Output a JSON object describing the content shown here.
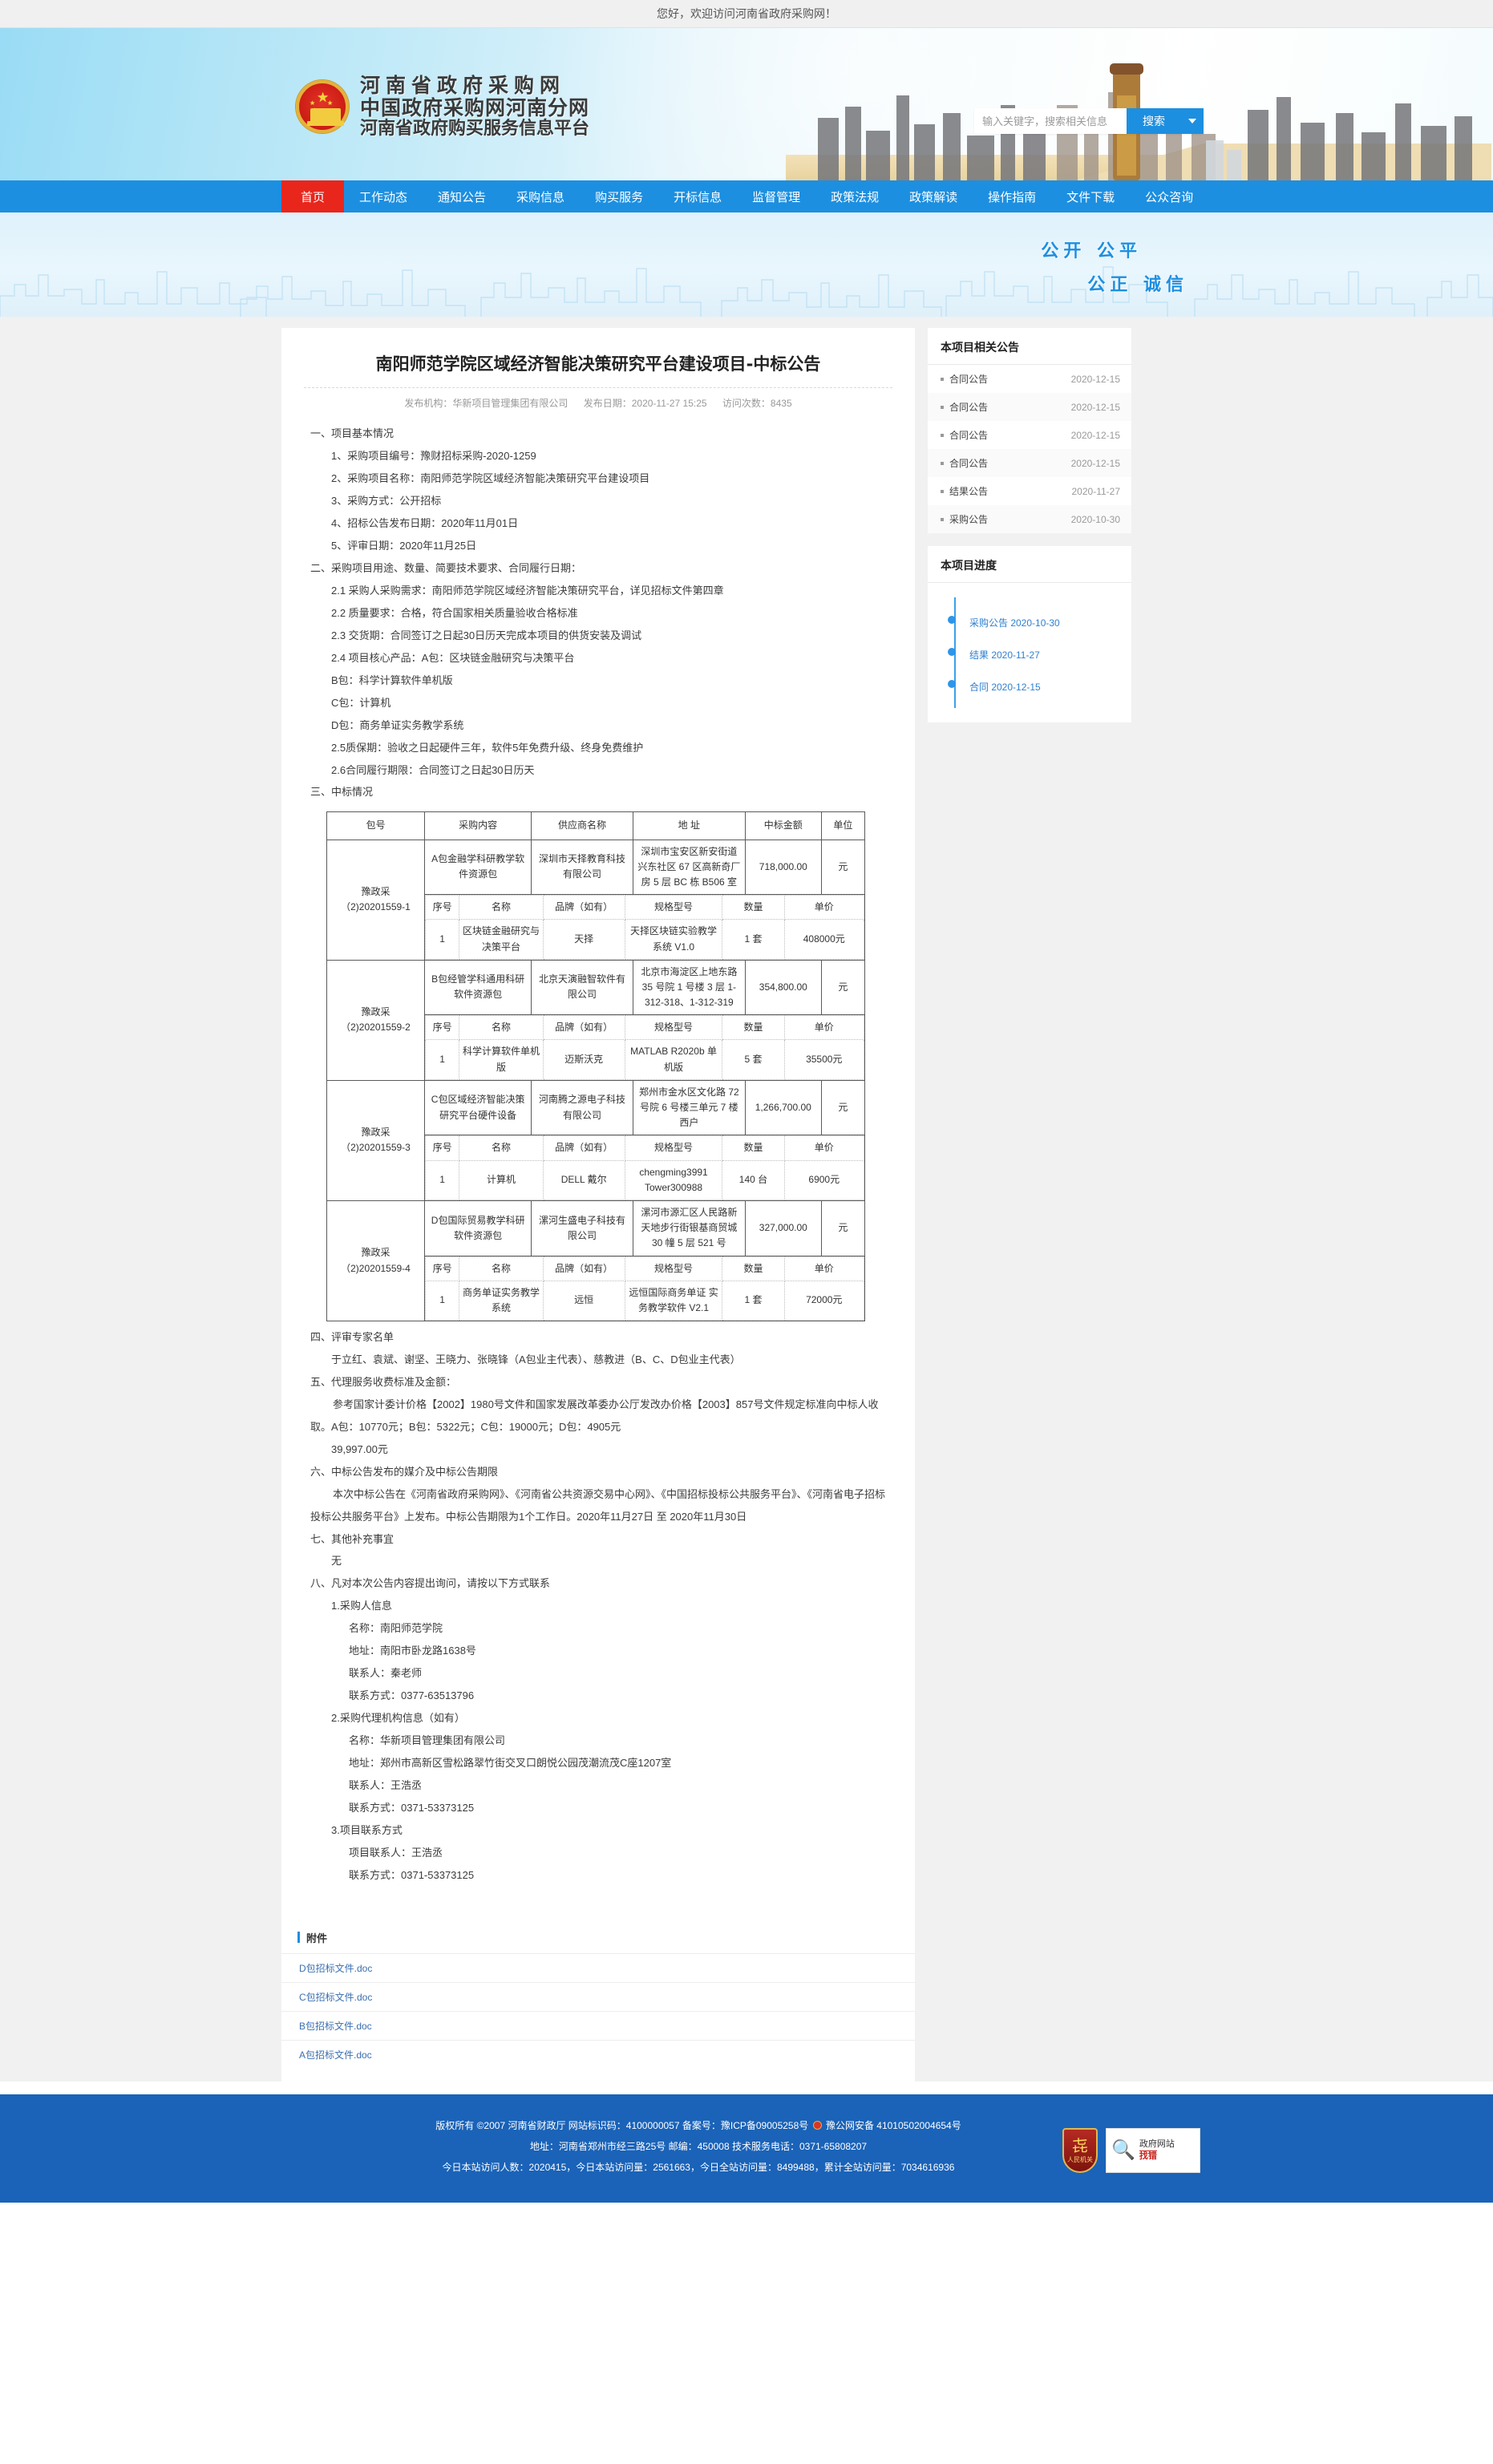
{
  "topbar": {
    "greeting": "您好，欢迎访问河南省政府采购网！"
  },
  "header": {
    "site_title_1": "河南省政府采购网",
    "site_title_2": "中国政府采购网河南分网",
    "site_title_3": "河南省政府购买服务信息平台",
    "search_placeholder": "输入关键字，搜索相关信息",
    "search_value": "",
    "search_button": "搜索"
  },
  "nav": {
    "items": [
      {
        "label": "首页",
        "active": true
      },
      {
        "label": "工作动态"
      },
      {
        "label": "通知公告"
      },
      {
        "label": "采购信息"
      },
      {
        "label": "购买服务"
      },
      {
        "label": "开标信息"
      },
      {
        "label": "监督管理"
      },
      {
        "label": "政策法规"
      },
      {
        "label": "政策解读"
      },
      {
        "label": "操作指南"
      },
      {
        "label": "文件下载"
      },
      {
        "label": "公众咨询"
      }
    ]
  },
  "banner": {
    "slogan_line1": "公开    公平",
    "slogan_line2": "公正    诚信"
  },
  "article": {
    "title": "南阳师范学院区域经济智能决策研究平台建设项目-中标公告",
    "meta_publisher": "发布机构：华新项目管理集团有限公司",
    "meta_date": "发布日期：2020-11-27 15:25",
    "meta_views": "访问次数：8435",
    "s1_head": "一、项目基本情况",
    "s1_1": "1、采购项目编号：豫财招标采购-2020-1259",
    "s1_2": "2、采购项目名称：南阳师范学院区域经济智能决策研究平台建设项目",
    "s1_3": "3、采购方式：公开招标",
    "s1_4": "4、招标公告发布日期：2020年11月01日",
    "s1_5": "5、评审日期：2020年11月25日",
    "s2_head": "二、采购项目用途、数量、简要技术要求、合同履行日期：",
    "s2_1": "2.1 采购人采购需求：南阳师范学院区域经济智能决策研究平台，详见招标文件第四章",
    "s2_2": "2.2 质量要求：合格，符合国家相关质量验收合格标准",
    "s2_3": "2.3 交货期：合同签订之日起30日历天完成本项目的供货安装及调试",
    "s2_4": "2.4 项目核心产品：A包：区块链金融研究与决策平台",
    "s2_4b": "B包：科学计算软件单机版",
    "s2_4c": "C包：计算机",
    "s2_4d": "D包：商务单证实务教学系统",
    "s2_5": "2.5质保期：验收之日起硬件三年，软件5年免费升级、终身免费维护",
    "s2_6": "2.6合同履行期限：合同签订之日起30日历天",
    "s3_head": "三、中标情况",
    "s4_head": "四、评审专家名单",
    "s4_body": "于立红、袁斌、谢坚、王晓力、张晓锋（A包业主代表）、慈教进（B、C、D包业主代表）",
    "s5_head": "五、代理服务收费标准及金额：",
    "s5_body": "参考国家计委计价格【2002】1980号文件和国家发展改革委办公厅发改办价格【2003】857号文件规定标准向中标人收取。A包：10770元；B包：5322元；C包：19000元；D包：4905元",
    "s5_total": "39,997.00元",
    "s6_head": "六、中标公告发布的媒介及中标公告期限",
    "s6_body": "本次中标公告在《河南省政府采购网》、《河南省公共资源交易中心网》、《中国招标投标公共服务平台》、《河南省电子招标投标公共服务平台》上发布。中标公告期限为1个工作日。2020年11月27日 至 2020年11月30日",
    "s7_head": "七、其他补充事宜",
    "s7_body": "无",
    "s8_head": "八、凡对本次公告内容提出询问，请按以下方式联系",
    "c1_head": "1.采购人信息",
    "c1_name": "名称：南阳师范学院",
    "c1_addr": "地址：南阳市卧龙路1638号",
    "c1_person": "联系人：秦老师",
    "c1_tel": "联系方式：0377-63513796",
    "c2_head": "2.采购代理机构信息（如有）",
    "c2_name": "名称：华新项目管理集团有限公司",
    "c2_addr": "地址：郑州市高新区雪松路翠竹街交叉口朗悦公园茂潮流茂C座1207室",
    "c2_person": "联系人：王浩丞",
    "c2_tel": "联系方式：0371-53373125",
    "c3_head": "3.项目联系方式",
    "c3_person": "项目联系人：王浩丞",
    "c3_tel": "联系方式：0371-53373125"
  },
  "table": {
    "headers": [
      "包号",
      "采购内容",
      "供应商名称",
      "地 址",
      "中标金额",
      "单位"
    ],
    "sub_headers": [
      "序号",
      "名称",
      "品牌（如有）",
      "规格型号",
      "数量",
      "单价"
    ],
    "packages": [
      {
        "pkg_no": "豫政采（2)20201559-1",
        "content": "A包金融学科研教学软件资源包",
        "supplier": "深圳市天择教育科技有限公司",
        "address": "深圳市宝安区新安街道兴东社区 67 区高新奇厂房 5 层 BC 栋 B506 室",
        "amount": "718,000.00",
        "unit": "元",
        "items": [
          {
            "no": "1",
            "name": "区块链金融研究与 决策平台",
            "brand": "天择",
            "spec": "天择区块链实验教学系统 V1.0",
            "qty": "1 套",
            "price": "408000元"
          }
        ]
      },
      {
        "pkg_no": "豫政采（2)20201559-2",
        "content": "B包经管学科通用科研软件资源包",
        "supplier": "北京天演融智软件有限公司",
        "address": "北京市海淀区上地东路 35 号院 1 号楼 3 层 1-312-318、1-312-319",
        "amount": "354,800.00",
        "unit": "元",
        "items": [
          {
            "no": "1",
            "name": "科学计算软件单机版",
            "brand": "迈斯沃克",
            "spec": "MATLAB R2020b 单机版",
            "qty": "5 套",
            "price": "35500元"
          }
        ]
      },
      {
        "pkg_no": "豫政采（2)20201559-3",
        "content": "C包区域经济智能决策研究平台硬件设备",
        "supplier": "河南腾之源电子科技有限公司",
        "address": "郑州市金水区文化路 72 号院 6 号楼三单元 7 楼西户",
        "amount": "1,266,700.00",
        "unit": "元",
        "items": [
          {
            "no": "1",
            "name": "计算机",
            "brand": "DELL 戴尔",
            "spec": "chengming3991 Tower300988",
            "qty": "140 台",
            "price": "6900元"
          }
        ]
      },
      {
        "pkg_no": "豫政采（2)20201559-4",
        "content": "D包国际贸易教学科研软件资源包",
        "supplier": "漯河生盛电子科技有限公司",
        "address": "漯河市源汇区人民路新天地步行街银基商贸城 30 幢 5 层 521 号",
        "amount": "327,000.00",
        "unit": "元",
        "items": [
          {
            "no": "1",
            "name": "商务单证实务教学系统",
            "brand": "远恒",
            "spec": "远恒国际商务单证 实务教学软件 V2.1",
            "qty": "1 套",
            "price": "72000元"
          }
        ]
      }
    ]
  },
  "sidebar": {
    "related_title": "本项目相关公告",
    "related_items": [
      {
        "label": "合同公告",
        "date": "2020-12-15"
      },
      {
        "label": "合同公告",
        "date": "2020-12-15"
      },
      {
        "label": "合同公告",
        "date": "2020-12-15"
      },
      {
        "label": "合同公告",
        "date": "2020-12-15"
      },
      {
        "label": "结果公告",
        "date": "2020-11-27"
      },
      {
        "label": "采购公告",
        "date": "2020-10-30"
      }
    ],
    "progress_title": "本项目进度",
    "progress_items": [
      {
        "label": "采购公告 2020-10-30"
      },
      {
        "label": "结果 2020-11-27"
      },
      {
        "label": "合同 2020-12-15"
      }
    ]
  },
  "attachments": {
    "title": "附件",
    "files": [
      {
        "name": "D包招标文件.doc"
      },
      {
        "name": "C包招标文件.doc"
      },
      {
        "name": "B包招标文件.doc"
      },
      {
        "name": "A包招标文件.doc"
      }
    ]
  },
  "footer": {
    "line1_a": "版权所有 ©2007 河南省财政厅 网站标识码：4100000057 备案号：豫ICP备09005258号",
    "line1_b": "豫公网安备 41010502004654号",
    "line2": "地址：河南省郑州市经三路25号 邮编：450008 技术服务电话：0371-65808207",
    "line3": "今日本站访问人数：2020415，今日本站访问量：2561663，今日全站访问量：8499488，累计全站访问量：7034616936",
    "badge1_text": "人民机关",
    "badge2_top": "政府网站",
    "badge2_bottom": "找错"
  },
  "colors": {
    "primary_blue": "#1d8fe0",
    "nav_active_red": "#e8261c",
    "footer_blue": "#1a63b8",
    "link_blue": "#2f7fd0"
  }
}
